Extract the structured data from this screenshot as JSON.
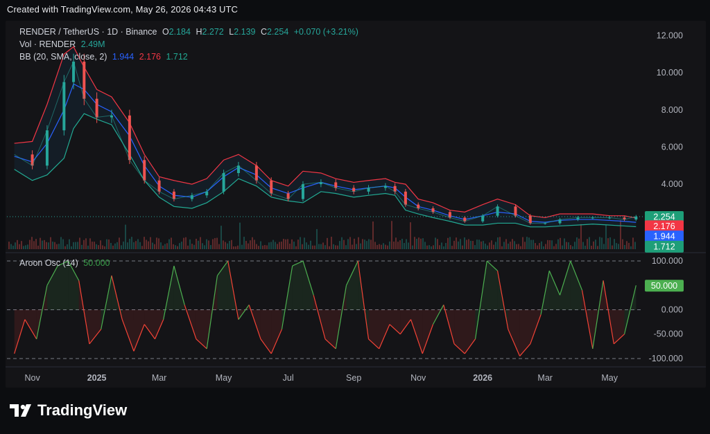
{
  "header": {
    "text": "Created with TradingView.com, May 26, 2026 04:43 UTC"
  },
  "legend": {
    "symbol": "RENDER / TetherUS · 1D · Binance",
    "o_label": "O",
    "o": "2.184",
    "h_label": "H",
    "h": "2.272",
    "l_label": "L",
    "l": "2.139",
    "c_label": "C",
    "c": "2.254",
    "change": "+0.070 (+3.21%)",
    "vol_label": "Vol · RENDER",
    "vol": "2.49M",
    "bb_label": "BB (20, SMA, close, 2)",
    "bb_basis": "1.944",
    "bb_upper": "2.176",
    "bb_lower": "1.712",
    "osc_label": "Aroon Osc (14)",
    "osc_value": "50.000"
  },
  "price_badges": {
    "close": "2.254",
    "upper": "2.176",
    "basis": "1.944",
    "lower": "1.712",
    "osc": "50.000"
  },
  "colors": {
    "up": "#26a69a",
    "down": "#ef5350",
    "basis": "#2962ff",
    "upper": "#f23645",
    "lower": "#22ab94",
    "osc_up": "#4caf50",
    "osc_down": "#f44336"
  },
  "footer": {
    "brand": "TradingView"
  },
  "chart_data": [
    {
      "type": "line",
      "title": "RENDER / TetherUS · 1D · Binance",
      "ylim": [
        0.5,
        12.8
      ],
      "y_ticks": [
        "12.000",
        "10.000",
        "8.000",
        "6.000",
        "4.000"
      ],
      "y_tick_values": [
        12,
        10,
        8,
        6,
        4
      ],
      "x_ticks": [
        "Nov",
        "2025",
        "Mar",
        "May",
        "Jul",
        "Sep",
        "Nov",
        "2026",
        "Mar",
        "May"
      ],
      "x": [
        "2024-10-15",
        "2024-11-01",
        "2024-11-15",
        "2024-12-01",
        "2024-12-10",
        "2024-12-20",
        "2025-01-01",
        "2025-01-15",
        "2025-02-01",
        "2025-02-15",
        "2025-03-01",
        "2025-03-15",
        "2025-04-01",
        "2025-04-15",
        "2025-05-01",
        "2025-05-15",
        "2025-06-01",
        "2025-06-15",
        "2025-07-01",
        "2025-07-15",
        "2025-08-01",
        "2025-08-15",
        "2025-09-01",
        "2025-09-15",
        "2025-10-01",
        "2025-10-10",
        "2025-10-20",
        "2025-11-01",
        "2025-11-15",
        "2025-12-01",
        "2025-12-15",
        "2026-01-01",
        "2026-01-15",
        "2026-02-01",
        "2026-02-15",
        "2026-03-01",
        "2026-03-15",
        "2026-04-01",
        "2026-04-15",
        "2026-05-01",
        "2026-05-15",
        "2026-05-26"
      ],
      "series": [
        {
          "name": "",
          "values": [
            5.6,
            5.0,
            6.9,
            9.5,
            10.6,
            8.6,
            7.6,
            7.7,
            5.3,
            4.2,
            3.6,
            3.2,
            3.4,
            3.6,
            4.6,
            5.0,
            4.2,
            3.5,
            3.2,
            4.0,
            4.1,
            3.8,
            3.6,
            3.8,
            3.9,
            3.6,
            2.9,
            2.7,
            2.5,
            2.2,
            2.0,
            2.3,
            2.8,
            2.3,
            1.9,
            1.9,
            2.1,
            2.2,
            2.2,
            2.2,
            2.1,
            2.254
          ]
        },
        {
          "name": "",
          "values": [
            6.2,
            6.3,
            8.3,
            11.0,
            11.4,
            10.3,
            9.1,
            8.7,
            7.3,
            5.6,
            4.4,
            4.2,
            4.0,
            4.3,
            5.3,
            5.6,
            5.0,
            4.2,
            3.9,
            4.7,
            4.6,
            4.3,
            4.1,
            4.2,
            4.3,
            4.1,
            4.0,
            3.2,
            3.0,
            2.6,
            2.5,
            2.9,
            3.2,
            2.9,
            2.3,
            2.2,
            2.4,
            2.4,
            2.4,
            2.3,
            2.3,
            2.176
          ]
        },
        {
          "name": "",
          "values": [
            5.5,
            5.2,
            6.2,
            8.0,
            9.4,
            9.1,
            8.3,
            7.9,
            6.6,
            5.0,
            3.9,
            3.4,
            3.3,
            3.6,
            4.4,
            4.9,
            4.5,
            3.8,
            3.5,
            3.8,
            4.1,
            3.9,
            3.7,
            3.8,
            3.9,
            3.8,
            3.3,
            2.8,
            2.6,
            2.3,
            2.1,
            2.3,
            2.5,
            2.4,
            2.0,
            1.95,
            2.05,
            2.1,
            2.1,
            2.05,
            2.0,
            1.944
          ]
        },
        {
          "name": "",
          "values": [
            4.8,
            4.2,
            4.5,
            5.4,
            7.0,
            7.8,
            7.5,
            7.2,
            5.6,
            4.2,
            3.3,
            2.8,
            2.7,
            3.0,
            3.6,
            4.3,
            3.9,
            3.3,
            3.1,
            3.0,
            3.6,
            3.5,
            3.3,
            3.4,
            3.5,
            3.4,
            2.6,
            2.4,
            2.2,
            2.0,
            1.8,
            1.8,
            1.9,
            1.9,
            1.7,
            1.7,
            1.75,
            1.8,
            1.85,
            1.8,
            1.75,
            1.712
          ]
        }
      ]
    },
    {
      "type": "area",
      "title": "Aroon Osc (14)",
      "ylim": [
        -110,
        110
      ],
      "y_ticks": [
        "100.000",
        "50.000",
        "0.000",
        "-50.000",
        "-100.000"
      ],
      "y_tick_values": [
        100,
        50,
        0,
        -50,
        -100
      ],
      "x": [
        "2024-10-15",
        "2024-10-25",
        "2024-11-05",
        "2024-11-15",
        "2024-11-25",
        "2024-12-05",
        "2024-12-15",
        "2024-12-25",
        "2025-01-05",
        "2025-01-15",
        "2025-01-25",
        "2025-02-05",
        "2025-02-15",
        "2025-02-25",
        "2025-03-05",
        "2025-03-15",
        "2025-03-25",
        "2025-04-05",
        "2025-04-15",
        "2025-04-25",
        "2025-05-05",
        "2025-05-15",
        "2025-05-25",
        "2025-06-05",
        "2025-06-15",
        "2025-06-25",
        "2025-07-05",
        "2025-07-15",
        "2025-07-25",
        "2025-08-05",
        "2025-08-15",
        "2025-08-25",
        "2025-09-05",
        "2025-09-15",
        "2025-09-25",
        "2025-10-05",
        "2025-10-15",
        "2025-10-25",
        "2025-11-05",
        "2025-11-15",
        "2025-11-25",
        "2025-12-05",
        "2025-12-15",
        "2025-12-25",
        "2026-01-05",
        "2026-01-15",
        "2026-01-25",
        "2026-02-05",
        "2026-02-15",
        "2026-02-25",
        "2026-03-05",
        "2026-03-15",
        "2026-03-25",
        "2026-04-05",
        "2026-04-15",
        "2026-04-25",
        "2026-05-05",
        "2026-05-15",
        "2026-05-26"
      ],
      "values": [
        -90,
        -20,
        -60,
        50,
        90,
        100,
        60,
        -70,
        -40,
        70,
        -20,
        -85,
        -30,
        -60,
        -20,
        90,
        10,
        -60,
        -80,
        70,
        100,
        -20,
        10,
        -60,
        -90,
        -40,
        90,
        100,
        30,
        -60,
        -80,
        50,
        100,
        -60,
        -80,
        -30,
        -50,
        -20,
        -90,
        -30,
        10,
        -70,
        -90,
        -60,
        100,
        80,
        -40,
        -95,
        -70,
        -10,
        80,
        30,
        100,
        40,
        -80,
        60,
        -70,
        -50,
        50
      ]
    }
  ]
}
